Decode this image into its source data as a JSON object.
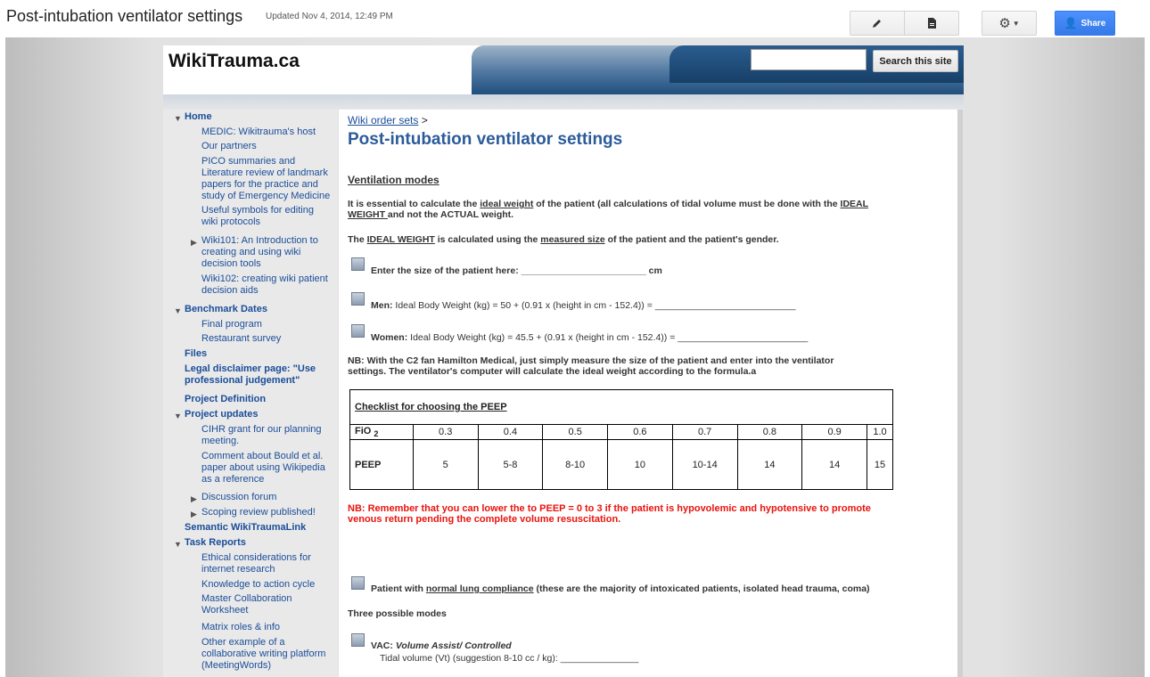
{
  "topbar": {
    "page_title": "Post-intubation ventilator settings",
    "updated": "Updated Nov 4, 2014, 12:49 PM",
    "edit_icon": "pencil-icon",
    "page_icon": "new-page-icon",
    "gear_icon": "gear-icon",
    "share_label": "Share"
  },
  "header": {
    "site_title": "WikiTrauma.ca",
    "search_placeholder": "",
    "search_button": "Search this site"
  },
  "sidebar": {
    "home": "Home",
    "home_items": [
      "MEDIC: Wikitrauma's host",
      "Our partners",
      "PICO summaries and",
      "Literature review of landmark",
      "papers for the practice and",
      "study of Emergency Medicine",
      "Useful symbols for editing",
      "wiki protocols",
      "Wiki101: An Introduction to",
      "creating and using wiki",
      "decision tools",
      "Wiki102: creating wiki patient",
      "decision aids"
    ],
    "benchmark": "Benchmark Dates",
    "benchmark_items": [
      "Final program",
      "Restaurant survey"
    ],
    "files": "Files",
    "legal_1": "Legal disclaimer page: \"Use",
    "legal_2": "professional judgement\"",
    "project_def": "Project Definition",
    "project_updates": "Project updates",
    "project_items": [
      "CIHR grant for our planning",
      "meeting.",
      "Comment about Bould et al.",
      "paper about using Wikipedia",
      "as a reference",
      "Discussion forum",
      "Scoping review published!"
    ],
    "semantic": "Semantic WikiTraumaLink",
    "task_reports": "Task Reports",
    "task_items": [
      "Ethical considerations for",
      "internet research",
      "Knowledge to action cycle",
      "Master Collaboration",
      "Worksheet",
      "Matrix roles & info",
      "Other example of a",
      "collaborative writing platform",
      "(MeetingWords)"
    ]
  },
  "main": {
    "breadcrumb_link": "Wiki order sets",
    "breadcrumb_sep": ">",
    "heading": "Post-intubation ventilator settings",
    "ventilation_modes": "Ventilation modes",
    "p1_a": "It is essential to calculate the ",
    "p1_link": "ideal weight",
    "p1_b": " of the patient (all calculations of tidal volume must be done with the ",
    "p1_c": "IDEAL",
    "p1_d": "WEIGHT ",
    "p1_e": "and not the ACTUAL weight.",
    "p2_a": "The ",
    "p2_b": "IDEAL WEIGHT",
    "p2_c": " is calculated using the ",
    "p2_d": "measured size",
    "p2_e": " of the patient and the patient's gender.",
    "size_line": "Enter the size of the patient here: ________________________ cm",
    "men_label": "Men:",
    "men_formula": " Ideal Body Weight (kg) = 50 + (0.91 x (height in cm - 152.4)) = ___________________________",
    "women_label": "Women:",
    "women_formula": " Ideal Body Weight (kg) = 45.5 + (0.91 x (height in cm - 152.4)) = _________________________",
    "nb1_a": "NB: With the C2 fan Hamilton Medical, just simply measure the size of the patient and enter into the ventilator",
    "nb1_b": "settings. The ventilator's computer will calculate the ideal weight according to the formula.a",
    "table": {
      "title": "Checklist for choosing the PEEP",
      "fio_label": "FiO",
      "fio_sub": "2",
      "peep_label": "PEEP",
      "fio": [
        "0.3",
        "0.4",
        "0.5",
        "0.6",
        "0.7",
        "0.8",
        "0.9",
        "1.0"
      ],
      "peep": [
        "5",
        "5-8",
        "8-10",
        "10",
        "10-14",
        "14",
        "14",
        "15"
      ]
    },
    "nb2_a": "NB: Remember that you can lower the to PEEP = 0 to 3 if the patient is hypovolemic and hypotensive to promote",
    "nb2_b": "venous return pending the complete volume resuscitation.",
    "normal_a": "Patient with ",
    "normal_link": "normal lung compliance",
    "normal_b": " (these are the majority of intoxicated patients, isolated head trauma, coma)",
    "three_modes": "Three possible modes",
    "vac_label": "VAC: ",
    "vac_title": "Volume Assist/ Controlled",
    "tidal": "Tidal volume (Vt) (suggestion 8-10 cc / kg): _______________"
  },
  "colors": {
    "link": "#1a4d99",
    "alert": "#e8140e",
    "share": "#4d90fe"
  }
}
